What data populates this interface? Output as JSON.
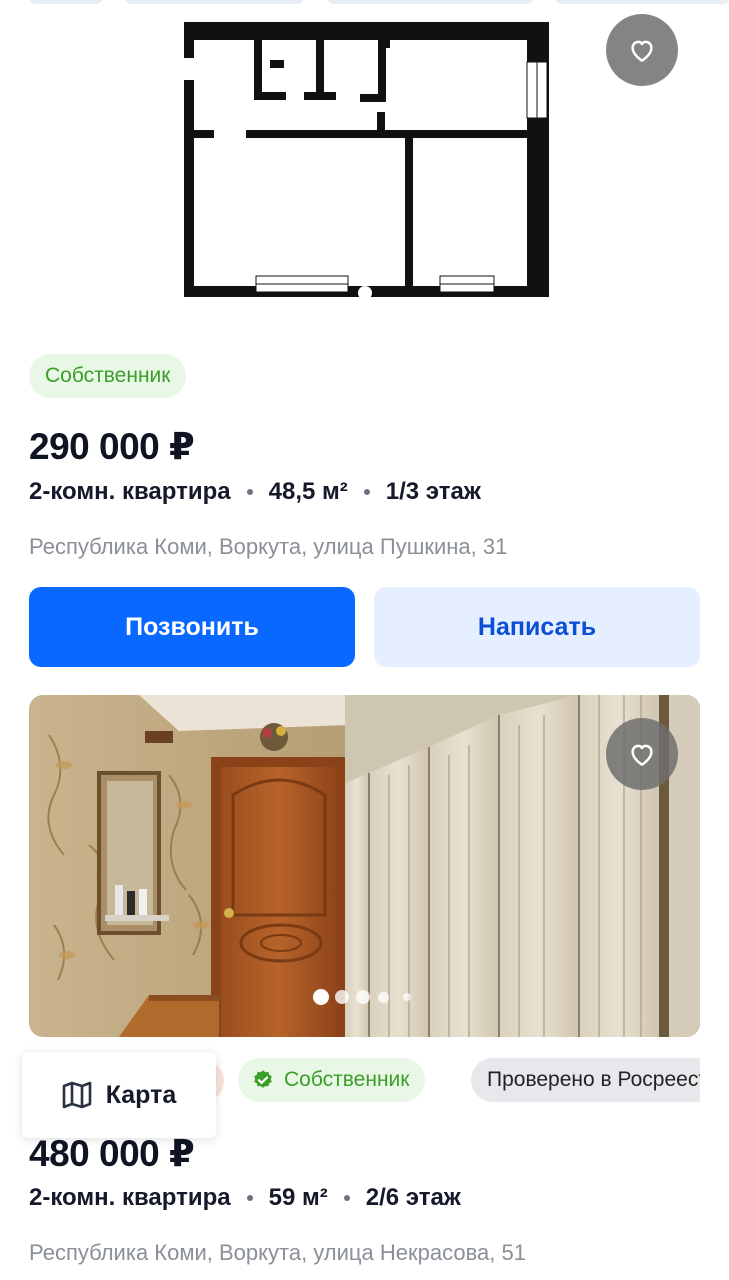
{
  "listings": [
    {
      "badge": "Собственник",
      "price": "290 000 ₽",
      "rooms": "2-комн. квартира",
      "area": "48,5 м²",
      "floor": "1/3 этаж",
      "address": "Республика Коми, Воркута, улица Пушкина, 31",
      "call_label": "Позвонить",
      "write_label": "Написать"
    },
    {
      "badges": [
        "Собственник",
        "Проверено в Росреестре"
      ],
      "price": "480 000 ₽",
      "rooms": "2-комн. квартира",
      "area": "59 м²",
      "floor": "2/6 этаж",
      "address": "Республика Коми, Воркута, улица Некрасова, 51",
      "photo_count_dots": 5,
      "active_photo_index": 0
    }
  ],
  "map_button": {
    "label": "Карта"
  },
  "colors": {
    "accent": "#0868ff",
    "owner_badge_bg": "#e9f7e7",
    "owner_badge_text": "#3a9e28"
  },
  "icons": [
    "heart-icon",
    "verified-check-icon",
    "map-icon"
  ]
}
